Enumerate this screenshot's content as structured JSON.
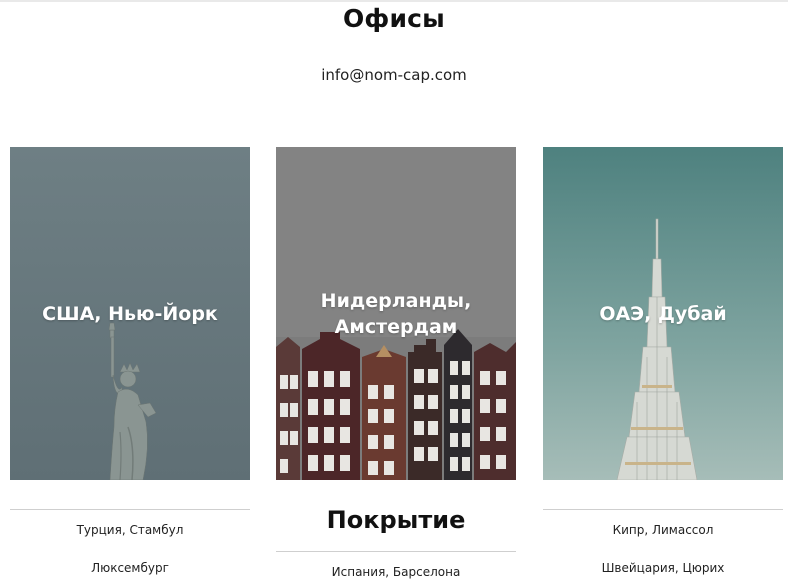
{
  "offices": {
    "title": "Офисы",
    "email": "info@nom-cap.com",
    "cards": [
      {
        "label": "США, Нью-Йорк"
      },
      {
        "label_line1": "Нидерланды,",
        "label_line2": "Амстердам"
      },
      {
        "label": "ОАЭ, Дубай"
      }
    ]
  },
  "coverage": {
    "title": "Покрытие",
    "left": [
      "Турция, Стамбул",
      "Люксембург"
    ],
    "center": [
      "Испания, Барселона"
    ],
    "right": [
      "Кипр, Лимассол",
      "Швейцария, Цюрих"
    ]
  }
}
